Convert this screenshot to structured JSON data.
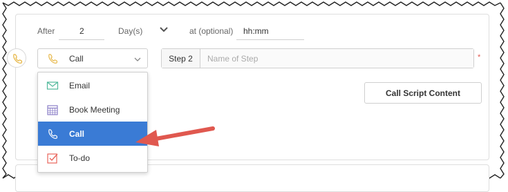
{
  "timing": {
    "after_label": "After",
    "after_value": "2",
    "unit_label": "Day(s)",
    "at_label": "at (optional)",
    "time_value": "hh:mm"
  },
  "step": {
    "type_selected": "Call",
    "step_label": "Step 2",
    "name_placeholder": "Name of Step",
    "required_mark": "*"
  },
  "buttons": {
    "call_script": "Call Script Content"
  },
  "dropdown": {
    "items": [
      {
        "label": "Email",
        "icon": "email-icon"
      },
      {
        "label": "Book Meeting",
        "icon": "calendar-icon"
      },
      {
        "label": "Call",
        "icon": "phone-icon",
        "selected": true
      },
      {
        "label": "To-do",
        "icon": "checkbox-icon"
      }
    ]
  },
  "colors": {
    "accent": "#3a7bd5",
    "arrow": "#e0584f",
    "call_icon": "#e7b84a",
    "email_icon": "#4fb89a",
    "meeting_icon": "#8b7fc7",
    "todo_icon": "#e8645a"
  }
}
